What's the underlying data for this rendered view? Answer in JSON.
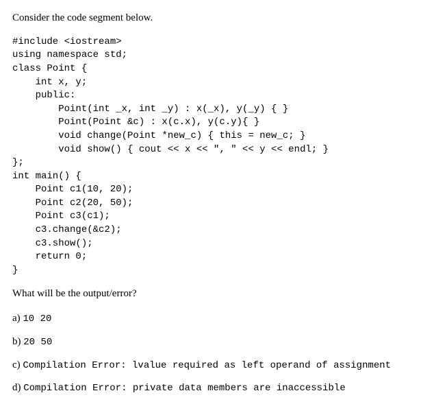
{
  "intro": "Consider the code segment below.",
  "code": "#include <iostream>\nusing namespace std;\nclass Point {\n    int x, y;\n    public:\n        Point(int _x, int _y) : x(_x), y(_y) { }\n        Point(Point &c) : x(c.x), y(c.y){ }\n        void change(Point *new_c) { this = new_c; }\n        void show() { cout << x << \", \" << y << endl; }\n};\nint main() {\n    Point c1(10, 20);\n    Point c2(20, 50);\n    Point c3(c1);\n    c3.change(&c2);\n    c3.show();\n    return 0;\n}",
  "question": "What will be the output/error?",
  "options": {
    "a": {
      "label": "a)",
      "text": "10 20"
    },
    "b": {
      "label": "b)",
      "text": "20 50"
    },
    "c": {
      "label": "c)",
      "text": "Compilation Error:  lvalue required as left operand of assignment"
    },
    "d": {
      "label": "d)",
      "text": "Compilation Error:  private data members are inaccessible"
    }
  }
}
